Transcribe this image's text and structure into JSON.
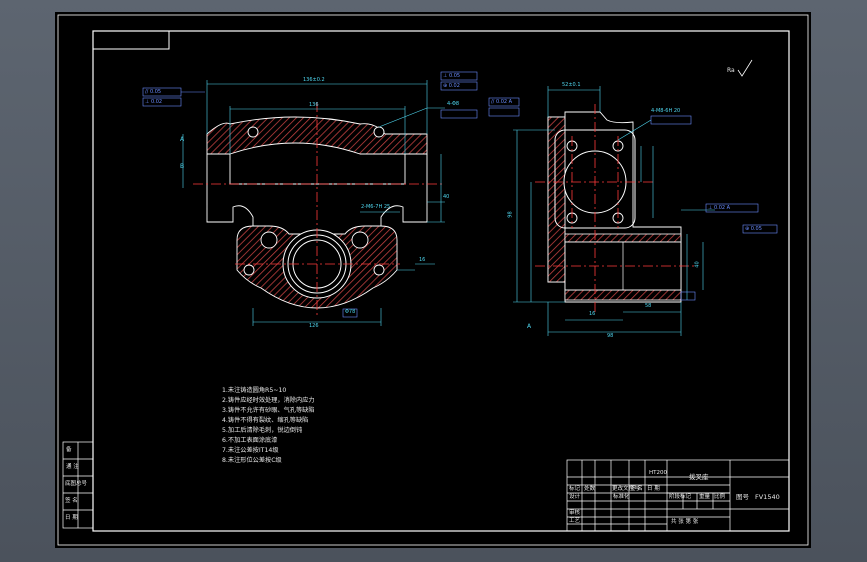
{
  "colors": {
    "background": "#555c66",
    "sheet": "#000000",
    "outline": "#ffffff",
    "dimension": "#4fd7f0",
    "centerline": "#ff3a3a",
    "hatch": "#c04040",
    "tolerance": "#6a8cff",
    "label": "#e8d44a"
  },
  "icons": [
    "roughness-symbol-icon",
    "datum-symbol-icon"
  ],
  "front_view": {
    "top_dim": "136±0.2",
    "width_dim": "136",
    "bore_dim": "Φ78",
    "base_dim": "126",
    "depth_dim": "2-M6-7H 25",
    "side_dim_a": "40",
    "side_dim_b": "16",
    "fcf_1": "// 0.05",
    "fcf_2": "⊥ 0.02",
    "fcf_3": "⊥ 0.05",
    "fcf_4": "⊕ 0.02",
    "hole_spec": "4-Φ8",
    "datum_a": "A",
    "datum_b": "B"
  },
  "side_view": {
    "top_dim": "52±0.1",
    "fcf_top": "// 0.02 A",
    "fcf_right_1": "⊥ 0.02 A",
    "fcf_right_2": "⊕ 0.05",
    "hole_spec": "4-M8-6H 20",
    "height_dim": "98",
    "length_dim": "98",
    "bottom_dim_a": "16",
    "bottom_dim_b": "58",
    "bottom_dim_c": "40",
    "datum_a": "A"
  },
  "roughness": "Ra",
  "notes": [
    "1.未注铸造圆角R5~10",
    "2.铸件应经时效处理，消除内应力",
    "3.铸件不允许有砂眼、气孔等缺陷",
    "4.铸件不得有裂纹、缩孔等缺陷",
    "5.加工后清除毛刺，锐边倒钝",
    "6.不加工表面涂底漆",
    "7.未注公差按IT14级",
    "8.未注形位公差按C级"
  ],
  "left_strip": [
    "备",
    "通 注",
    "底图总号",
    "签 名",
    "日 期"
  ],
  "title_block": {
    "part_name": "拨叉座",
    "drawing_no": "图号",
    "code": "FV1540",
    "rows": [
      "标记",
      "处数",
      "更改文件号",
      "签 名",
      "日 期"
    ],
    "role_design": "设计",
    "role_check": "审核",
    "role_approve": "工艺",
    "stage": "阶段标记",
    "weight": "重量",
    "scale": "比例",
    "sheets": "共 张 第 张",
    "standard": "标准化",
    "material": "HT200"
  }
}
